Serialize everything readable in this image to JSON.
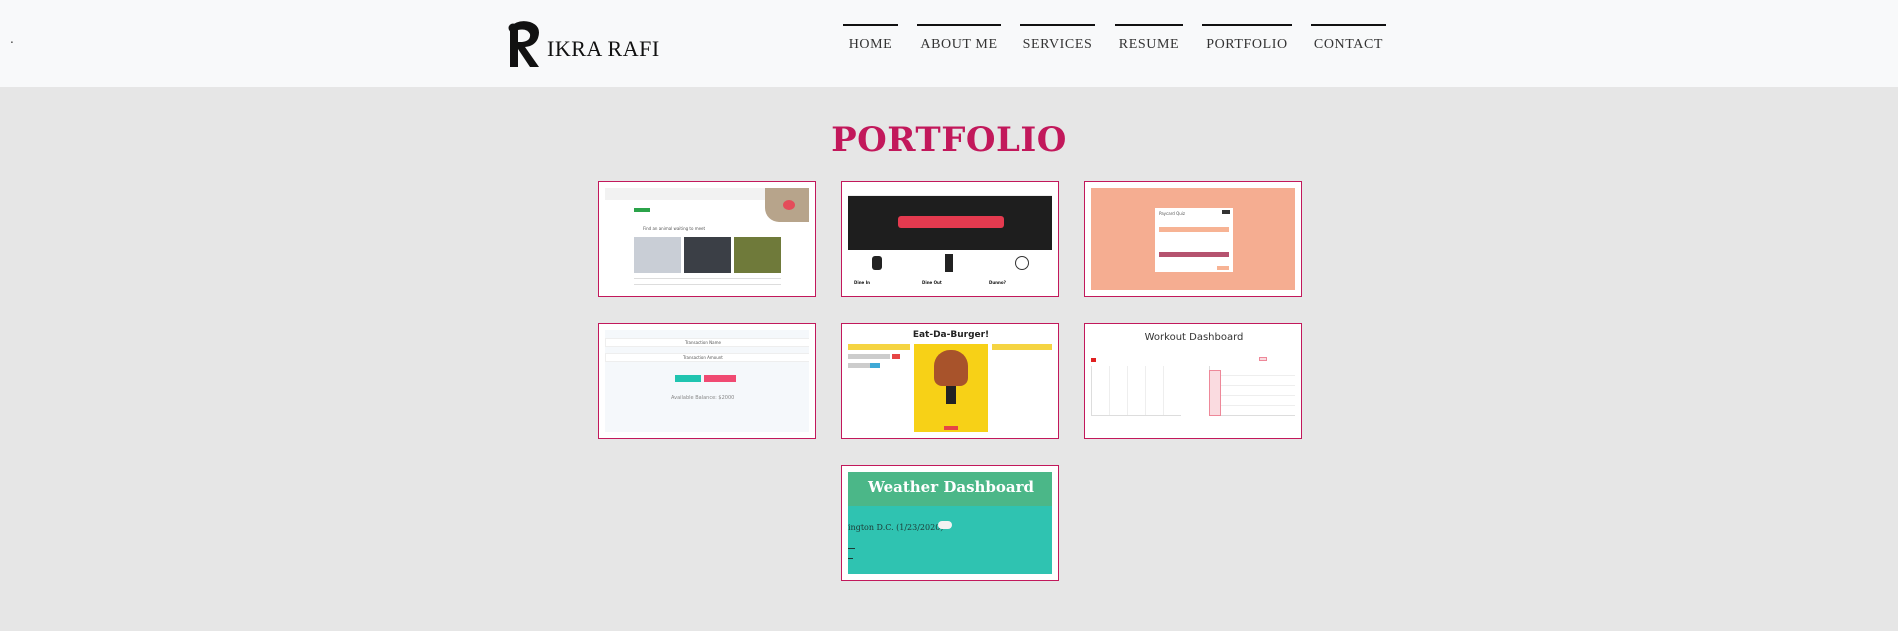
{
  "header": {
    "brand_initial": "R",
    "brand_name": "IKRA RAFI",
    "dot": ".",
    "nav": [
      {
        "label": "HOME"
      },
      {
        "label": "ABOUT ME"
      },
      {
        "label": "SERVICES"
      },
      {
        "label": "RESUME"
      },
      {
        "label": "PORTFOLIO"
      },
      {
        "label": "CONTACT"
      }
    ]
  },
  "main": {
    "title": "PORTFOLIO",
    "projects": [
      {
        "screenshot_text": "Find an animal waiting to meet"
      },
      {
        "screenshot_text": "Foodsville is a multidisciplinary, research engine to guide your food's hunt",
        "captions": [
          "Dine In",
          "Dine Out",
          "Dunno?"
        ]
      },
      {
        "screenshot_text": "Paycard Quiz"
      },
      {
        "screenshot_text": "Transaction Name",
        "field2": "Transaction Amount",
        "btn1": "Add Funds",
        "btn2": "Subtract Funds",
        "balance": "Available Balance: $2000"
      },
      {
        "screenshot_text": "Eat-Da-Burger!"
      },
      {
        "screenshot_text": "Workout Dashboard"
      },
      {
        "screenshot_text": "Weather Dashboard",
        "sub": "ington D.C. (1/23/2020)"
      }
    ]
  },
  "colors": {
    "accent": "#c2185b",
    "header_bg": "#f8f9fa",
    "page_bg": "#e6e6e6"
  }
}
